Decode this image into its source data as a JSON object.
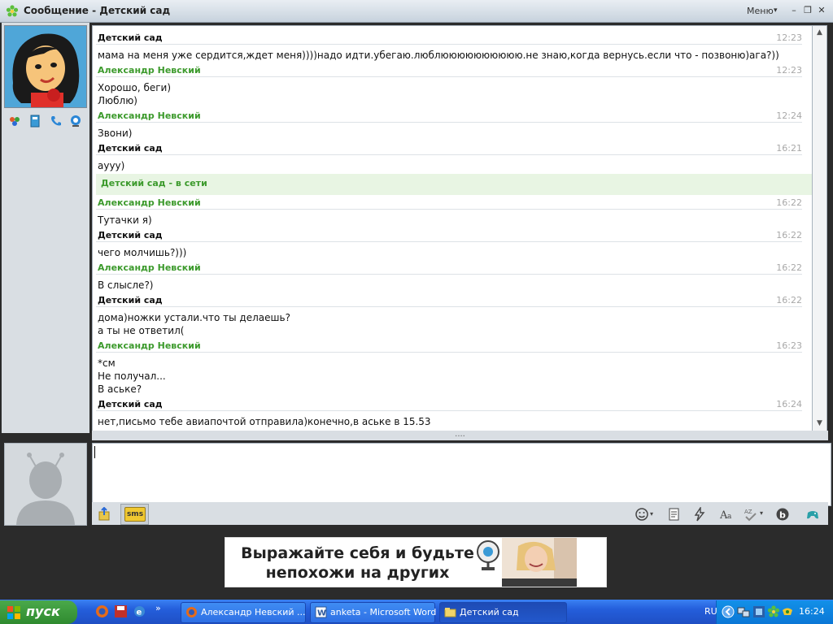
{
  "window": {
    "title": "Сообщение - Детский сад",
    "menu_label": "Меню"
  },
  "messages": [
    {
      "sender": "Детский сад",
      "color": "black",
      "time": "12:23",
      "text": "мама на меня уже сердится,ждет меня))))надо идти.убегаю.люблюююююююююю.не знаю,когда вернусь.если что - позвоню)ага?))"
    },
    {
      "sender": "Александр Невский",
      "color": "green",
      "time": "12:23",
      "text": "Хорошо, беги)\nЛюблю)"
    },
    {
      "sender": "Александр Невский",
      "color": "green",
      "time": "12:24",
      "text": "Звони)"
    },
    {
      "sender": "Детский сад",
      "color": "black",
      "time": "16:21",
      "text": "аууу)"
    },
    {
      "sender": "Александр Невский",
      "color": "green",
      "time": "16:22",
      "text": "Тутачки я)"
    },
    {
      "sender": "Детский сад",
      "color": "black",
      "time": "16:22",
      "text": "чего молчишь?)))"
    },
    {
      "sender": "Александр Невский",
      "color": "green",
      "time": "16:22",
      "text": "В слысле?)"
    },
    {
      "sender": "Детский сад",
      "color": "black",
      "time": "16:22",
      "text": "дома)ножки устали.что ты делаешь?\nа ты не ответил("
    },
    {
      "sender": "Александр Невский",
      "color": "green",
      "time": "16:23",
      "text": "*см\nНе получал...\nВ аське?"
    },
    {
      "sender": "Детский сад",
      "color": "black",
      "time": "16:24",
      "text": "нет,письмо тебе авиапочтой отправила)конечно,в аське в 15.53"
    }
  ],
  "status_notice": "Детский сад - в сети",
  "splitter_grip": "....",
  "input": {
    "value": ""
  },
  "toolbar": {
    "sms_label": "sms"
  },
  "ad": {
    "line1": "Выражайте себя и будьте",
    "line2": "непохожи на других"
  },
  "taskbar": {
    "start_label": "пуск",
    "quicklaunch_more": "»",
    "tasks": [
      {
        "label": "Александр Невский ..."
      },
      {
        "label": "anketa - Microsoft Word"
      },
      {
        "label": "Детский сад"
      }
    ],
    "lang": "RU",
    "clock": "16:24"
  },
  "colors": {
    "green_sender": "#3c9a2c",
    "status_bg": "#e8f5e3",
    "taskbar": "#245edb"
  }
}
